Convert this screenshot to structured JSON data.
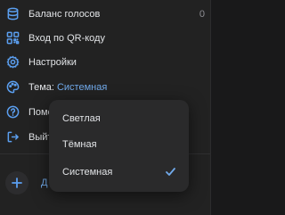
{
  "menu": {
    "items": [
      {
        "label": "Баланс голосов",
        "counter": "0",
        "icon": "database-icon"
      },
      {
        "label": "Вход по QR-коду",
        "icon": "qr-code-icon"
      },
      {
        "label": "Настройки",
        "icon": "gear-icon"
      },
      {
        "label": "Тема:",
        "value": "Системная",
        "icon": "palette-icon"
      },
      {
        "label": "Помо",
        "icon": "help-icon"
      },
      {
        "label": "Выйт",
        "icon": "logout-icon"
      }
    ],
    "add_label": "Д"
  },
  "theme_dropdown": {
    "options": [
      {
        "label": "Светлая",
        "selected": false
      },
      {
        "label": "Тёмная",
        "selected": false
      },
      {
        "label": "Системная",
        "selected": true
      }
    ]
  },
  "colors": {
    "accent": "#71aaeb",
    "icon": "#5b9ff0",
    "background": "#19191a",
    "panel": "#222222",
    "dropdown": "#2a2a2b"
  }
}
